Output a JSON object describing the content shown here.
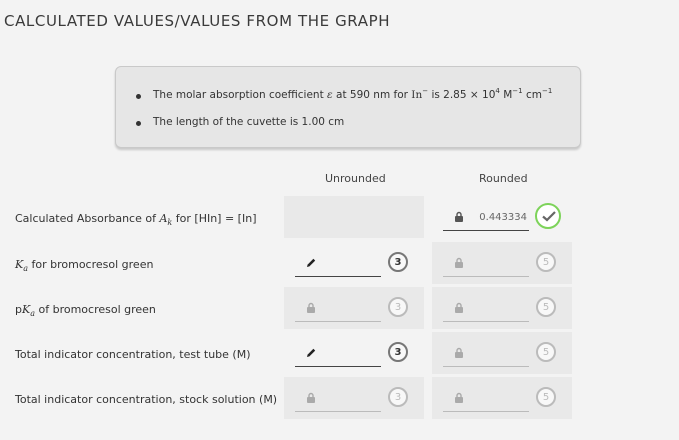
{
  "section_title": "CALCULATED VALUES/VALUES FROM THE GRAPH",
  "info": {
    "line1_pre": "The molar absorption coefficient",
    "line1_symbol": "ε",
    "line1_mid": "at 590 nm for",
    "line1_species": "In",
    "line1_species_sup": "−",
    "line1_is": "is 2.85 × 10",
    "line1_exp": "4",
    "line1_unit1": "M",
    "line1_unit1_exp": "−1",
    "line1_unit2": "cm",
    "line1_unit2_exp": "−1",
    "line2": "The length of the cuvette is 1.00 cm"
  },
  "columns": {
    "unrounded": "Unrounded",
    "rounded": "Rounded"
  },
  "rows": [
    {
      "label_pre": "Calculated Absorbance of",
      "label_math": "A",
      "label_sub": "k",
      "label_post": "for [HIn] = [In]",
      "unrounded_value": "",
      "unrounded_points": "",
      "rounded_value": "0.443334",
      "rounded_points": "✓"
    },
    {
      "label_math": "K",
      "label_sub": "a",
      "label_post": "for bromocresol green",
      "unrounded_value": "",
      "unrounded_points": "3",
      "rounded_value": "",
      "rounded_points": "5"
    },
    {
      "label_pre": "p",
      "label_math": "K",
      "label_sub": "a",
      "label_post": "of bromocresol green",
      "unrounded_value": "",
      "unrounded_points": "3",
      "rounded_value": "",
      "rounded_points": "5"
    },
    {
      "label_post": "Total indicator concentration, test tube (M)",
      "unrounded_value": "",
      "unrounded_points": "3",
      "rounded_value": "",
      "rounded_points": "5"
    },
    {
      "label_post": "Total indicator concentration, stock solution (M)",
      "unrounded_value": "",
      "unrounded_points": "3",
      "rounded_value": "",
      "rounded_points": "5"
    }
  ],
  "icons": {
    "edit": "pencil-icon",
    "locked": "lock-icon",
    "complete": "check-icon"
  },
  "colors": {
    "success": "#7dd35a",
    "cell_background": "#e9e9e9",
    "page_background": "#f3f3f3"
  }
}
